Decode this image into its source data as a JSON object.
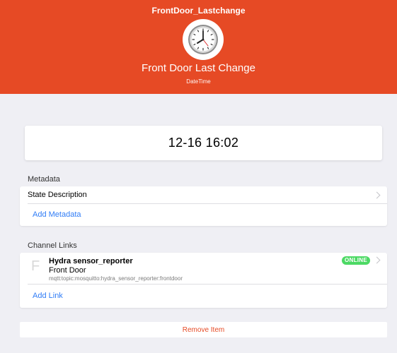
{
  "header": {
    "item_name": "FrontDoor_Lastchange",
    "label": "Front Door Last Change",
    "type": "DateTime",
    "icon": "clock-icon",
    "color": "#e64a25"
  },
  "state": {
    "value": "12-16 16:02"
  },
  "metadata": {
    "title": "Metadata",
    "items": [
      {
        "label": "State Description"
      }
    ],
    "add_label": "Add Metadata"
  },
  "channel_links": {
    "title": "Channel Links",
    "items": [
      {
        "letter": "F",
        "title": "Hydra sensor_reporter",
        "subtitle": "Front Door",
        "uid": "mqtt:topic:mosquitto:hydra_sensor_reporter:frontdoor",
        "status": "ONLINE",
        "status_color": "#4cd964"
      }
    ],
    "add_label": "Add Link"
  },
  "remove_label": "Remove Item",
  "colors": {
    "accent": "#e64a25",
    "link": "#2f7cf6",
    "background": "#efeff4"
  }
}
